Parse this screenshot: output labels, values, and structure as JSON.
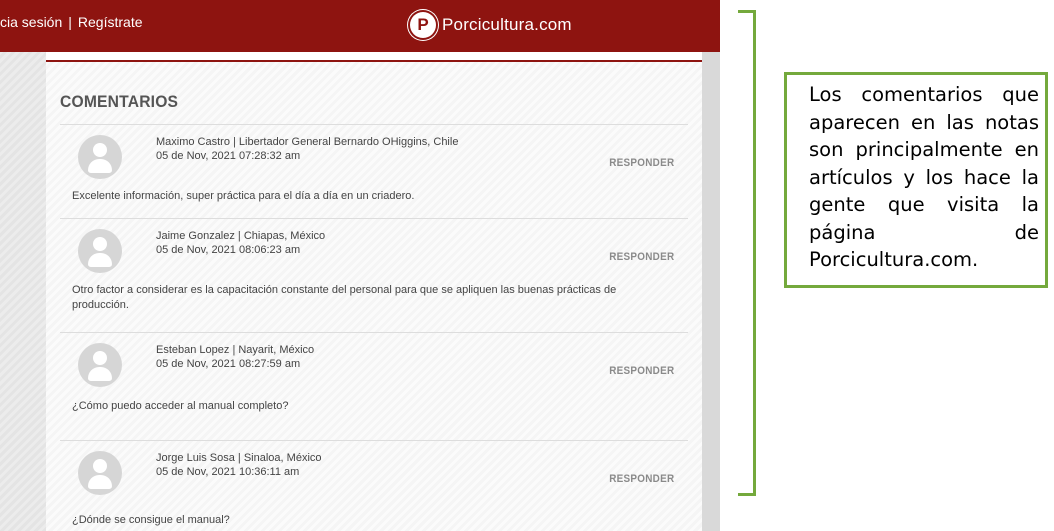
{
  "topbar": {
    "login_label": "cia sesión",
    "separator": "|",
    "register_label": "Regístrate",
    "logo_letter": "P",
    "logo_text": "Porcicultura.com"
  },
  "comments_title": "COMENTARIOS",
  "comments": [
    {
      "author": "Maximo Castro | Libertador General Bernardo OHiggins, Chile",
      "date": "05 de Nov, 2021 07:28:32 am",
      "reply_label": "RESPONDER",
      "text": "Excelente información, super práctica para el día a día en un criadero."
    },
    {
      "author": "Jaime Gonzalez | Chiapas, México",
      "date": "05 de Nov, 2021 08:06:23 am",
      "reply_label": "RESPONDER",
      "text": "Otro factor a considerar es la capacitación constante del personal para que se apliquen las buenas prácticas de producción."
    },
    {
      "author": "Esteban Lopez | Nayarit, México",
      "date": "05 de Nov, 2021 08:27:59 am",
      "reply_label": "RESPONDER",
      "text": "¿Cómo puedo acceder al manual completo?"
    },
    {
      "author": "Jorge Luis Sosa | Sinaloa, México",
      "date": "05 de Nov, 2021 10:36:11 am",
      "reply_label": "RESPONDER",
      "text": "¿Dónde se consigue el manual?"
    }
  ],
  "annotation": {
    "text": "Los comentarios que aparecen en las notas son principalmente en artículos y los hace la gente que visita la página de Porcicultura.com."
  },
  "colors": {
    "brand_red": "#8e1410",
    "annotation_green": "#74a93c"
  },
  "icons": [
    "logo-p-icon",
    "user-avatar-icon"
  ]
}
